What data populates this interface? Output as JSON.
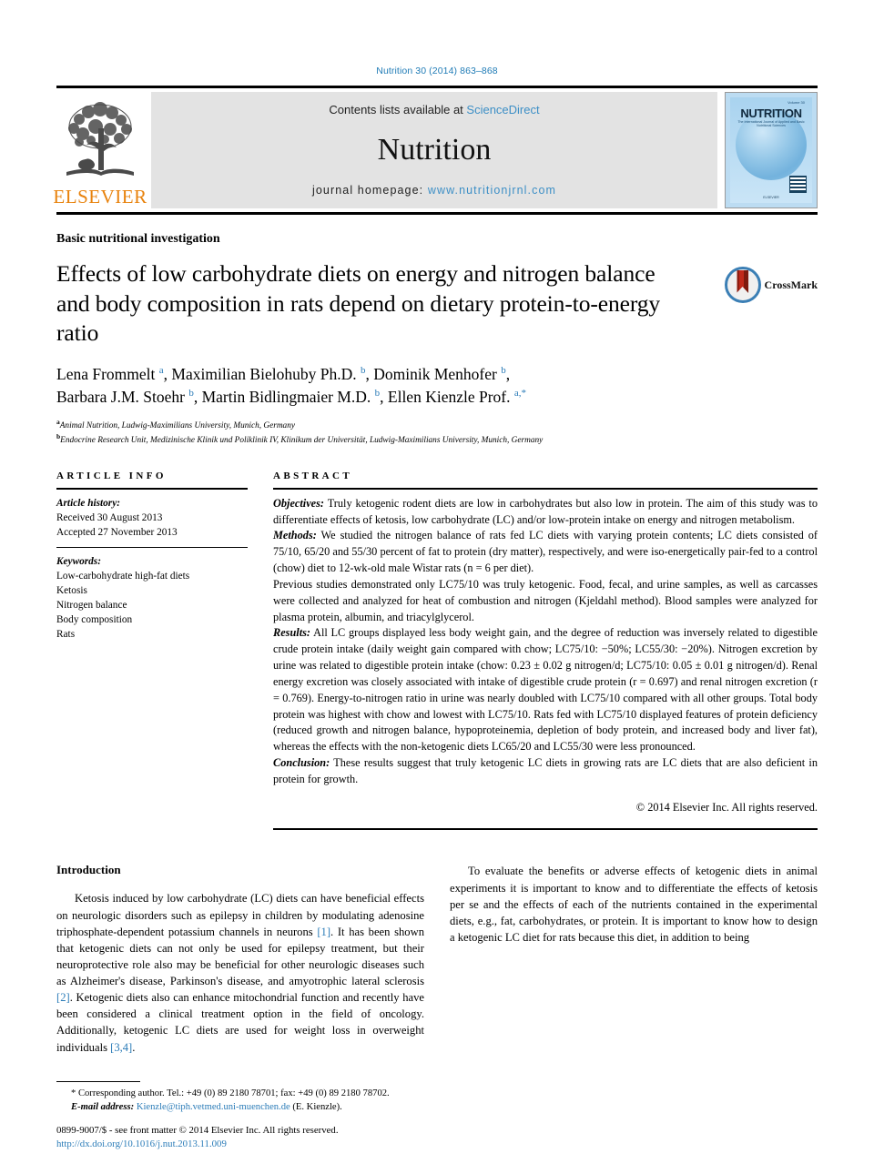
{
  "running_head": "Nutrition 30 (2014) 863–868",
  "masthead": {
    "publisher_name": "ELSEVIER",
    "contents_prefix": "Contents lists available at ",
    "contents_link": "ScienceDirect",
    "journal_name": "Nutrition",
    "homepage_prefix": "journal homepage: ",
    "homepage_url": "www.nutritionjrnl.com",
    "cover": {
      "title": "NUTRITION",
      "volume_label": "Volume 30",
      "subtitle": "The International Journal of Applied and Basic Nutritional Sciences",
      "footer": "ELSEVIER"
    }
  },
  "article": {
    "type": "Basic nutritional investigation",
    "title": "Effects of low carbohydrate diets on energy and nitrogen balance and body composition in rats depend on dietary protein-to-energy ratio",
    "crossmark_label": "CrossMark",
    "authors_line_1": "Lena Frommelt <sup>a</sup>, Maximilian Bielohuby Ph.D. <sup>b</sup>, Dominik Menhofer <sup>b</sup>,",
    "authors_line_2": "Barbara J.M. Stoehr <sup>b</sup>, Martin Bidlingmaier M.D. <sup>b</sup>, Ellen Kienzle Prof. <sup>a,*</sup>",
    "affiliation_a": "Animal Nutrition, Ludwig-Maximilians University, Munich, Germany",
    "affiliation_b": "Endocrine Research Unit, Medizinische Klinik und Poliklinik IV, Klinikum der Universität, Ludwig-Maximilians University, Munich, Germany"
  },
  "article_info": {
    "heading": "ARTICLE INFO",
    "history_label": "Article history:",
    "received": "Received 30 August 2013",
    "accepted": "Accepted 27 November 2013",
    "keywords_label": "Keywords:",
    "keywords": [
      "Low-carbohydrate high-fat diets",
      "Ketosis",
      "Nitrogen balance",
      "Body composition",
      "Rats"
    ]
  },
  "abstract": {
    "heading": "ABSTRACT",
    "objectives_label": "Objectives:",
    "objectives_text": " Truly ketogenic rodent diets are low in carbohydrates but also low in protein. The aim of this study was to differentiate effects of ketosis, low carbohydrate (LC) and/or low-protein intake on energy and nitrogen metabolism.",
    "methods_label": "Methods:",
    "methods_text": " We studied the nitrogen balance of rats fed LC diets with varying protein contents; LC diets consisted of 75/10, 65/20 and 55/30 percent of fat to protein (dry matter), respectively, and were iso-energetically pair-fed to a control (chow) diet to 12-wk-old male Wistar rats (n = 6 per diet).",
    "methods_text_2": "Previous studies demonstrated only LC75/10 was truly ketogenic. Food, fecal, and urine samples, as well as carcasses were collected and analyzed for heat of combustion and nitrogen (Kjeldahl method). Blood samples were analyzed for plasma protein, albumin, and triacylglycerol.",
    "results_label": "Results:",
    "results_text": " All LC groups displayed less body weight gain, and the degree of reduction was inversely related to digestible crude protein intake (daily weight gain compared with chow; LC75/10: −50%; LC55/30: −20%). Nitrogen excretion by urine was related to digestible protein intake (chow: 0.23 ± 0.02 g nitrogen/d; LC75/10: 0.05 ± 0.01 g nitrogen/d). Renal energy excretion was closely associated with intake of digestible crude protein (r = 0.697) and renal nitrogen excretion (r = 0.769). Energy-to-nitrogen ratio in urine was nearly doubled with LC75/10 compared with all other groups. Total body protein was highest with chow and lowest with LC75/10. Rats fed with LC75/10 displayed features of protein deficiency (reduced growth and nitrogen balance, hypoproteinemia, depletion of body protein, and increased body and liver fat), whereas the effects with the non-ketogenic diets LC65/20 and LC55/30 were less pronounced.",
    "conclusion_label": "Conclusion:",
    "conclusion_text": " These results suggest that truly ketogenic LC diets in growing rats are LC diets that are also deficient in protein for growth.",
    "copyright": "© 2014 Elsevier Inc. All rights reserved."
  },
  "introduction": {
    "heading": "Introduction",
    "para_1_a": "Ketosis induced by low carbohydrate (LC) diets can have beneficial effects on neurologic disorders such as epilepsy in children by modulating adenosine triphosphate-dependent potassium channels in neurons ",
    "para_1_ref": "[1]",
    "para_1_b": ". It has been shown that ketogenic diets can not only be used for epilepsy treatment, but their neuroprotective role also may be beneficial for other neurologic diseases such as Alzheimer's disease, Parkinson's disease, and amyotrophic lateral sclerosis ",
    "para_1_ref2": "[2]",
    "para_1_c": ". Ketogenic diets also can enhance mitochondrial function and recently have been considered a clinical treatment option in the field of oncology. Additionally, ketogenic LC diets are used for weight loss in overweight individuals ",
    "para_1_ref3": "[3,4]",
    "para_1_d": ".",
    "para_2": "To evaluate the benefits or adverse effects of ketogenic diets in animal experiments it is important to know and to differentiate the effects of ketosis per se and the effects of each of the nutrients contained in the experimental diets, e.g., fat, carbohydrates, or protein. It is important to know how to design a ketogenic LC diet for rats because this diet, in addition to being"
  },
  "footnote": {
    "corresponding": "* Corresponding author. Tel.: +49 (0) 89 2180 78701; fax: +49 (0) 89 2180 78702.",
    "email_label": "E-mail address:",
    "email": "Kienzle@tiph.vetmed.uni-muenchen.de",
    "email_suffix": " (E. Kienzle).",
    "issn_line": "0899-9007/$ - see front matter © 2014 Elsevier Inc. All rights reserved.",
    "doi": "http://dx.doi.org/10.1016/j.nut.2013.11.009"
  },
  "colors": {
    "link": "#2b7cb8",
    "elsevier_orange": "#e8820c",
    "masthead_bg": "#e3e3e3"
  }
}
